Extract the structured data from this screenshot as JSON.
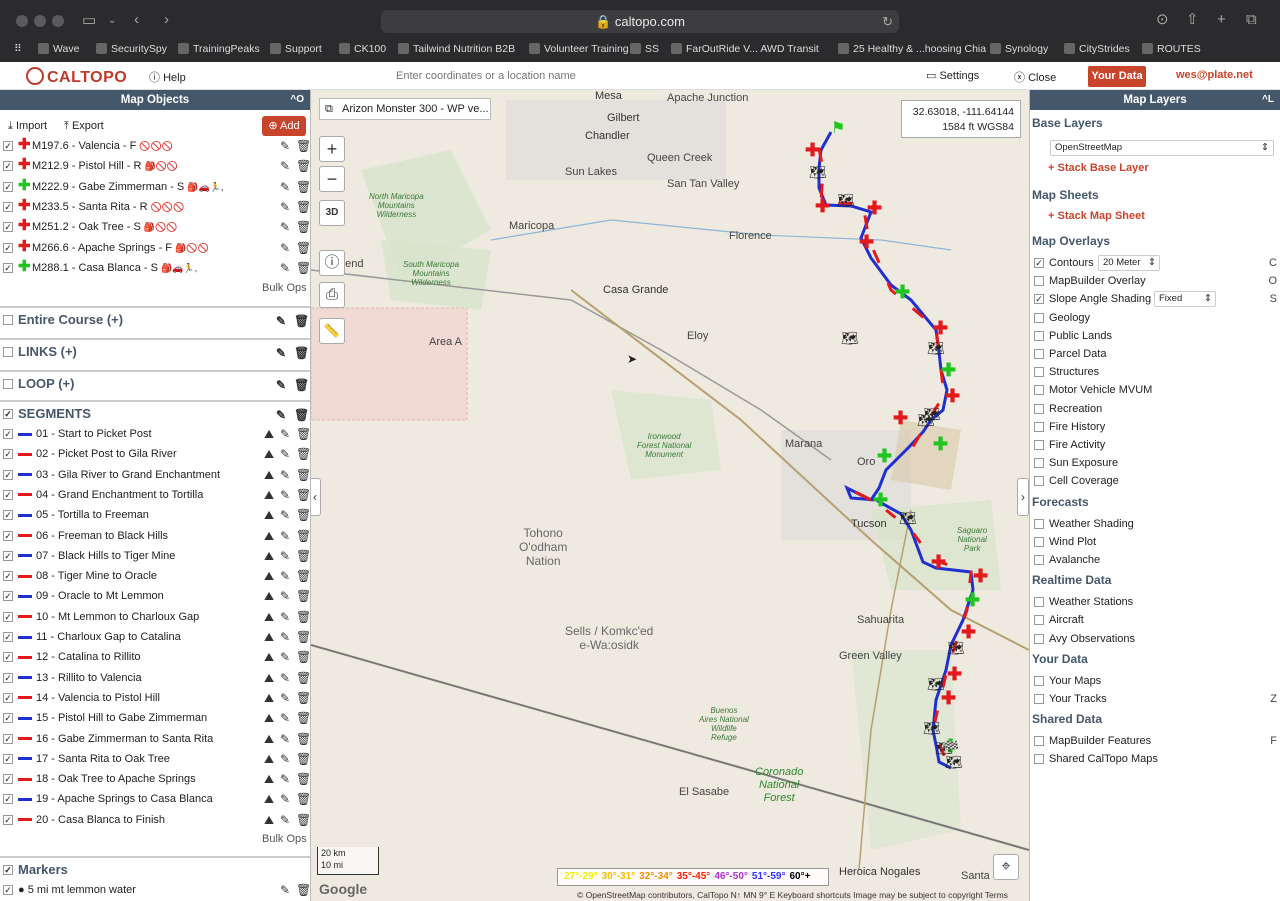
{
  "browser": {
    "url": "caltopo.com",
    "bookmarks": [
      "Wave",
      "SecuritySpy",
      "TrainingPeaks",
      "Support",
      "CK100",
      "Tailwind Nutrition B2B",
      "Volunteer Training",
      "SS",
      "FarOutRide V... AWD Transit",
      "25 Healthy & ...hoosing Chia",
      "Synology",
      "CityStrides",
      "ROUTES"
    ]
  },
  "app": {
    "logo": "CALTOPO",
    "help": "Help",
    "search_placeholder": "Enter coordinates or a location name",
    "settings": "Settings",
    "close": "Close",
    "your_data": "Your Data",
    "user": "wes@plate.net"
  },
  "left": {
    "title": "Map Objects",
    "collapse": "^O",
    "import": "Import",
    "export": "Export",
    "add": "Add",
    "markers_top": [
      {
        "label": "M197.6 - Valencia - F",
        "icons": "🚫🚫🚫",
        "color": "#e31a1c"
      },
      {
        "label": "M212.9 - Pistol Hill - R",
        "icons": "🎒🚫🚫",
        "color": "#e31a1c"
      },
      {
        "label": "M222.9 - Gabe Zimmerman - S",
        "icons": "🎒🚗🏃,",
        "color": "#22c422"
      },
      {
        "label": "M233.5 - Santa Rita - R",
        "icons": "🚫🚫🚫",
        "color": "#e31a1c"
      },
      {
        "label": "M251.2 - Oak Tree - S",
        "icons": "🎒🚫🚫",
        "color": "#e31a1c"
      },
      {
        "label": "M266.6 - Apache Springs - F",
        "icons": "🎒🚫🚫",
        "color": "#e31a1c"
      },
      {
        "label": "M288.1 - Casa Blanca - S",
        "icons": "🎒🚗🏃,",
        "color": "#22c422"
      }
    ],
    "bulk_ops": "Bulk Ops",
    "folders": [
      "Entire Course (+)",
      "LINKS (+)",
      "LOOP (+)"
    ],
    "segments_title": "SEGMENTS",
    "segments": [
      {
        "label": "01 - Start to Picket Post",
        "color": "#1f2fd0"
      },
      {
        "label": "02 - Picket Post to Gila River",
        "color": "#e31a1c"
      },
      {
        "label": "03 - Gila River to Grand Enchantment",
        "color": "#1f2fd0"
      },
      {
        "label": "04 - Grand Enchantment to Tortilla",
        "color": "#e31a1c"
      },
      {
        "label": "05 - Tortilla to Freeman",
        "color": "#1f2fd0"
      },
      {
        "label": "06 - Freeman to Black Hills",
        "color": "#e31a1c"
      },
      {
        "label": "07 - Black Hills to Tiger Mine",
        "color": "#1f2fd0"
      },
      {
        "label": "08 - Tiger Mine to Oracle",
        "color": "#e31a1c"
      },
      {
        "label": "09 - Oracle to Mt Lemmon",
        "color": "#1f2fd0"
      },
      {
        "label": "10 - Mt Lemmon to Charloux Gap",
        "color": "#e31a1c"
      },
      {
        "label": "11 - Charloux Gap to Catalina",
        "color": "#1f2fd0"
      },
      {
        "label": "12 - Catalina to Rillito",
        "color": "#e31a1c"
      },
      {
        "label": "13 - Rillito to Valencia",
        "color": "#1f2fd0"
      },
      {
        "label": "14 - Valencia to Pistol Hill",
        "color": "#e31a1c"
      },
      {
        "label": "15 - Pistol Hill to Gabe Zimmerman",
        "color": "#1f2fd0"
      },
      {
        "label": "16 - Gabe Zimmerman to Santa Rita",
        "color": "#e31a1c"
      },
      {
        "label": "17 - Santa Rita to Oak Tree",
        "color": "#1f2fd0"
      },
      {
        "label": "18 - Oak Tree to Apache Springs",
        "color": "#e31a1c"
      },
      {
        "label": "19 - Apache Springs to Casa Blanca",
        "color": "#1f2fd0"
      },
      {
        "label": "20 - Casa Blanca to Finish",
        "color": "#e31a1c"
      }
    ],
    "markers_title": "Markers",
    "marker_item": "5 mi mt lemmon water"
  },
  "map": {
    "map_title": "Arizon Monster 300 - WP ve...",
    "coord_line1": "32.63018, -111.64144",
    "coord_line2": "1584 ft   WGS84",
    "places": {
      "mesa": "Mesa",
      "gilbert": "Gilbert",
      "chandler": "Chandler",
      "apache_junction": "Apache Junction",
      "queen_creek": "Queen Creek",
      "sun_lakes": "Sun Lakes",
      "san_tan": "San Tan Valley",
      "maricopa": "Maricopa",
      "florence": "Florence",
      "casa_grande": "Casa Grande",
      "eloy": "Eloy",
      "area_a": "Area A",
      "marana": "Marana",
      "oro": "Oro",
      "tucson": "Tucson",
      "sahuarita": "Sahuarita",
      "green_valley": "Green Valley",
      "el_sasabe": "El Sasabe",
      "heroica": "Heroica Nogales",
      "santa_cr": "Santa Cr",
      "sells": "Sells / Komkc'ed\ne-Wa:osidk",
      "dend": "dend",
      "tohono": "Tohono\nO'odham\nNation",
      "nm_wild": "North Maricopa\nMountains\nWilderness",
      "sm_wild": "South Maricopa\nMountains\nWilderness",
      "ironwood": "Ironwood\nForest National\nMonument",
      "saguaro": "Saguaro\nNational\nPark",
      "buenos": "Buenos\nAires National\nWildlife\nRefuge",
      "coronado": "Coronado\nNational\nForest"
    },
    "scale_km": "20 km",
    "scale_mi": "10 mi",
    "google": "Google",
    "legend": [
      "27°-29°",
      "30°-31°",
      "32°-34°",
      "35°-45°",
      "46°-50°",
      "51°-59°",
      "60°+"
    ],
    "legend_colors": [
      "#f0f000",
      "#f0c000",
      "#f09000",
      "#ff2000",
      "#b030d0",
      "#3030ff",
      "#000000"
    ],
    "attribution": "© OpenStreetMap contributors, CalTopo  N↑ MN 9° E    Keyboard shortcuts    Image may be subject to copyright    Terms"
  },
  "right": {
    "title": "Map Layers",
    "collapse": "^L",
    "base_layers": "Base Layers",
    "base_value": "OpenStreetMap",
    "stack_base": "+ Stack Base Layer",
    "map_sheets": "Map Sheets",
    "stack_sheet": "+ Stack Map Sheet",
    "map_overlays": "Map Overlays",
    "overlays": [
      {
        "label": "Contours",
        "checked": true,
        "key": "C",
        "select": "20 Meter"
      },
      {
        "label": "MapBuilder Overlay",
        "checked": false,
        "key": "O"
      },
      {
        "label": "Slope Angle Shading",
        "checked": true,
        "key": "S",
        "select": "Fixed"
      },
      {
        "label": "Geology",
        "checked": false
      },
      {
        "label": "Public Lands",
        "checked": false
      },
      {
        "label": "Parcel Data",
        "checked": false
      },
      {
        "label": "Structures",
        "checked": false
      },
      {
        "label": "Motor Vehicle MVUM",
        "checked": false
      },
      {
        "label": "Recreation",
        "checked": false
      },
      {
        "label": "Fire History",
        "checked": false
      },
      {
        "label": "Fire Activity",
        "checked": false
      },
      {
        "label": "Sun Exposure",
        "checked": false
      },
      {
        "label": "Cell Coverage",
        "checked": false
      }
    ],
    "forecasts": "Forecasts",
    "forecast_items": [
      "Weather Shading",
      "Wind Plot",
      "Avalanche"
    ],
    "realtime": "Realtime Data",
    "realtime_items": [
      "Weather Stations",
      "Aircraft",
      "Avy Observations"
    ],
    "your_data": "Your Data",
    "your_items": [
      {
        "label": "Your Maps",
        "key": ""
      },
      {
        "label": "Your Tracks",
        "key": "Z"
      }
    ],
    "shared": "Shared Data",
    "shared_items": [
      {
        "label": "MapBuilder Features",
        "key": "F"
      },
      {
        "label": "Shared CalTopo Maps",
        "key": ""
      }
    ]
  }
}
